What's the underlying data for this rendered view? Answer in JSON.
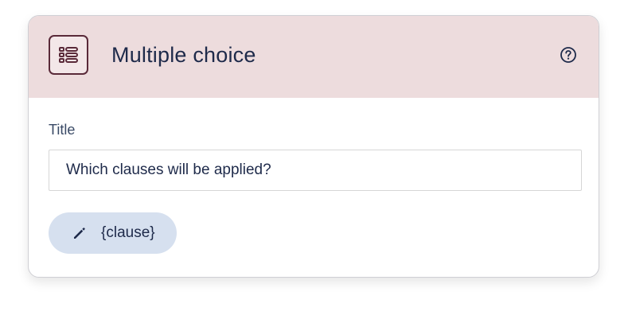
{
  "card": {
    "title": "Multiple choice",
    "type_icon": "list-icon",
    "help_icon": "help-circle-icon",
    "colors": {
      "header_background": "#eddcdd",
      "icon_stroke": "#5a2a39",
      "title_text": "#1e2a4a",
      "chip_background": "#d6e0ef"
    }
  },
  "form": {
    "title_label": "Title",
    "title_value": "Which clauses will be applied?",
    "variable_chip": {
      "icon": "pencil-icon",
      "label": "{clause}"
    }
  }
}
